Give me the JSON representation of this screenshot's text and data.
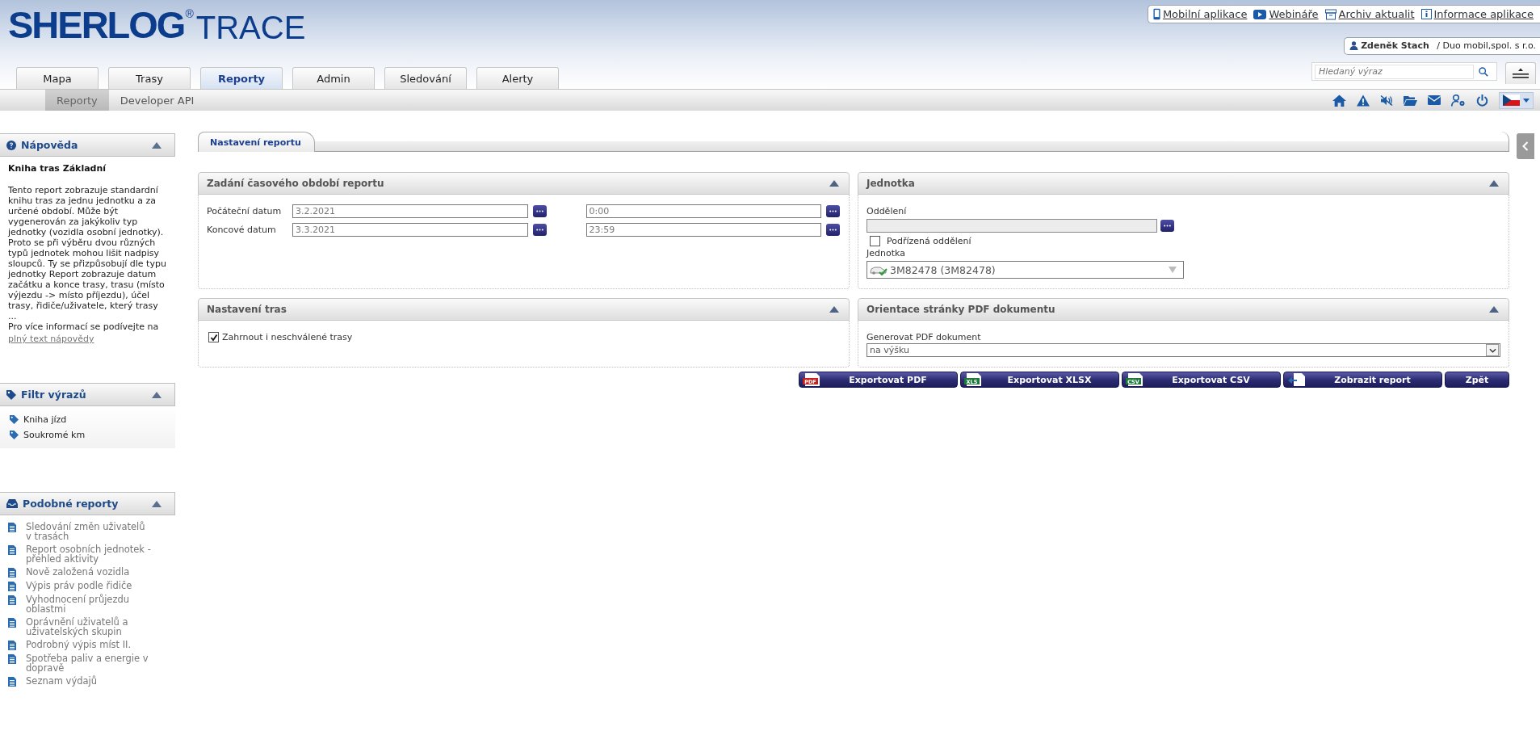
{
  "logo": {
    "name": "SHERLOG",
    "mark": "®",
    "suffix": "TRACE"
  },
  "links": [
    {
      "kind": "mobile",
      "label": "Mobilní aplikace"
    },
    {
      "kind": "video",
      "label": "Webináře"
    },
    {
      "kind": "archive",
      "label": "Archiv aktualit"
    },
    {
      "kind": "info",
      "label": "Informace aplikace"
    }
  ],
  "user": {
    "name": "Zdeněk Stach",
    "org": "/ Duo mobil,spol. s r.o."
  },
  "search": {
    "placeholder": "Hledaný výraz"
  },
  "nav_tabs": [
    {
      "label": "Mapa",
      "selected": false
    },
    {
      "label": "Trasy",
      "selected": false
    },
    {
      "label": "Reporty",
      "selected": true
    },
    {
      "label": "Admin",
      "selected": false
    },
    {
      "label": "Sledování",
      "selected": false
    },
    {
      "label": "Alerty",
      "selected": false
    }
  ],
  "sub_tabs": [
    {
      "label": "Reporty",
      "selected": true
    },
    {
      "label": "Developer API",
      "selected": false
    }
  ],
  "help": {
    "title": "Nápověda",
    "subtitle": "Kniha tras Základní",
    "paragraphs": [
      "Tento report zobrazuje standardní knihu tras za jednu jednotku a za určené období. Může být vygenerován za jakýkoliv typ jednotky (vozidla osobní jednotky). Proto se při výběru dvou různých typů jednotek mohou lišit nadpisy sloupců. Ty se přizpůsobují dle typu jednotky Report zobrazuje datum začátku a konce trasy, trasu (místo výjezdu -> místo příjezdu), účel trasy, řidiče/uživatele, který trasy",
      "...",
      "Pro více informací se podívejte na"
    ],
    "link": "plný text nápovědy"
  },
  "filters": {
    "title": "Filtr výrazů",
    "items": [
      "Kniha jízd",
      "Soukromé km"
    ]
  },
  "similar": {
    "title": "Podobné reporty",
    "items": [
      "Sledování změn uživatelů v trasách",
      "Report osobních jednotek - přehled aktivity",
      "Nově založená vozidla",
      "Výpis práv podle řidiče",
      "Vyhodnocení průjezdu oblastmi",
      "Oprávnění uživatelů a uživatelských skupin",
      "Podrobný výpis míst II.",
      "Spotřeba paliv a energie v dopravě",
      "Seznam výdajů"
    ]
  },
  "main_tab": "Nastavení reportu",
  "period": {
    "title": "Zadání časového období reportu",
    "rows": [
      {
        "label": "Počáteční datum",
        "date": "3.2.2021",
        "time": "0:00"
      },
      {
        "label": "Koncové datum",
        "date": "3.3.2021",
        "time": "23:59"
      }
    ]
  },
  "unit": {
    "title": "Jednotka",
    "department_label": "Oddělení",
    "subordinate": {
      "label": "Podřízená oddělení",
      "checked": false
    },
    "unit_label": "Jednotka",
    "unit_value": "3M82478 (3M82478)"
  },
  "routes": {
    "title": "Nastavení tras",
    "option": {
      "label": "Zahrnout i neschválené trasy",
      "checked": true
    }
  },
  "pdf": {
    "title": "Orientace stránky PDF dokumentu",
    "label": "Generovat PDF dokument",
    "value": "na výšku"
  },
  "buttons": [
    {
      "kind": "pdf",
      "label": "Exportovat PDF",
      "icon_text": "PDF"
    },
    {
      "kind": "xlsx",
      "label": "Exportovat XLSX",
      "icon_text": "XLS"
    },
    {
      "kind": "csv",
      "label": "Exportovat CSV",
      "icon_text": "CSV"
    },
    {
      "kind": "report",
      "label": "Zobrazit report"
    },
    {
      "kind": "back",
      "label": "Zpět"
    }
  ]
}
